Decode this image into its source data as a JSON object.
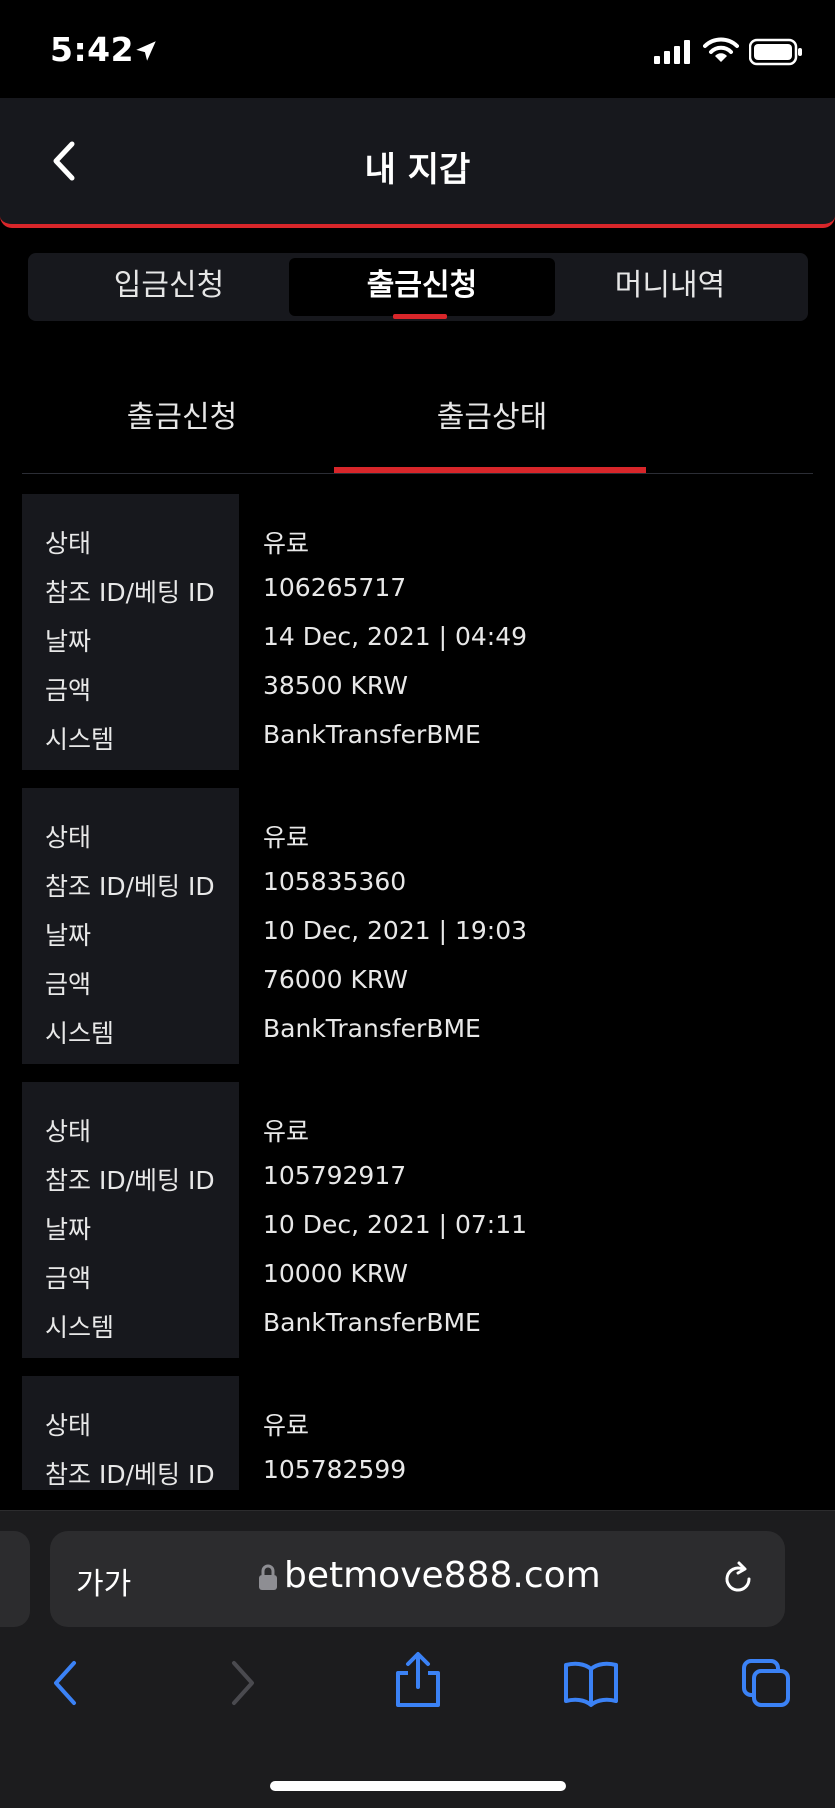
{
  "status_bar": {
    "time": "5:42"
  },
  "header": {
    "title": "내 지갑"
  },
  "main_tabs": [
    {
      "label": "입금신청"
    },
    {
      "label": "출금신청"
    },
    {
      "label": "머니내역"
    }
  ],
  "sub_tabs": [
    {
      "label": "출금신청"
    },
    {
      "label": "출금상태"
    }
  ],
  "labels": {
    "status": "상태",
    "ref_id": "참조 ID/베팅 ID",
    "date": "날짜",
    "amount": "금액",
    "system": "시스템"
  },
  "records": [
    {
      "status": "유료",
      "ref_id": "106265717",
      "date": "14 Dec, 2021 | 04:49",
      "amount": "38500 KRW",
      "system": "BankTransferBME"
    },
    {
      "status": "유료",
      "ref_id": "105835360",
      "date": "10 Dec, 2021 | 19:03",
      "amount": "76000 KRW",
      "system": "BankTransferBME"
    },
    {
      "status": "유료",
      "ref_id": "105792917",
      "date": "10 Dec, 2021 | 07:11",
      "amount": "10000 KRW",
      "system": "BankTransferBME"
    },
    {
      "status": "유료",
      "ref_id": "105782599",
      "date": "",
      "amount": "",
      "system": ""
    }
  ],
  "browser": {
    "text_size_label": "가가",
    "url": "betmove888.com"
  },
  "colors": {
    "accent": "#d8262a",
    "header_bg": "#17181d",
    "link_blue": "#3b82f6"
  }
}
